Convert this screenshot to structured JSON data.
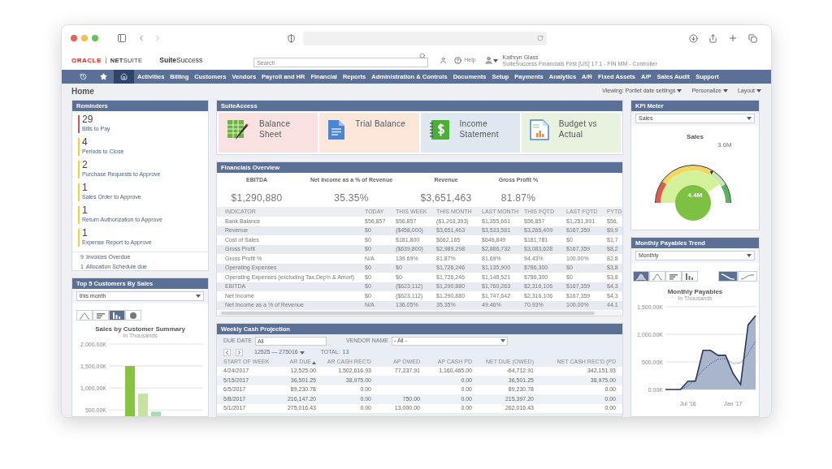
{
  "header": {
    "brand": "ORACLE",
    "product": "**NET**SUITE",
    "edition": "**Suite**Success",
    "search": {
      "placeholder": "Search"
    },
    "help": "Help",
    "user": {
      "name": "Kathryn Glass",
      "role": "SuiteSuccess Financials First [US] 17.1 - FIN MM - Controller"
    }
  },
  "nav": {
    "icons": [
      {
        "kind": "recent",
        "selected": false
      },
      {
        "kind": "favorites",
        "selected": false
      },
      {
        "kind": "home",
        "selected": true
      }
    ],
    "items": [
      "Activities",
      "Billing",
      "Customers",
      "Vendors",
      "Payroll and HR",
      "Financial",
      "Reports",
      "Administration & Controls",
      "Documents",
      "Setup",
      "Payments",
      "Analytics",
      "A/R",
      "Fixed Assets",
      "A/P",
      "Sales Audit",
      "Support"
    ]
  },
  "page": {
    "title": "Home",
    "links": [
      "Viewing: Portlet date settings",
      "Personalize",
      "Layout"
    ]
  },
  "reminders": {
    "title": "Reminders",
    "items": [
      {
        "count": "29",
        "label": "Bills to Pay",
        "color": "#d9534f"
      },
      {
        "count": "4",
        "label": "Periods to Close",
        "color": "#f2d22e"
      },
      {
        "count": "2",
        "label": "Purchase Requests to Approve",
        "color": "#f2d22e"
      },
      {
        "count": "1",
        "label": "Sales Order to Approve",
        "color": "#f2d22e"
      },
      {
        "count": "1",
        "label": "Return Authorization to Approve",
        "color": "#f2d22e"
      },
      {
        "count": "1",
        "label": "Expense Report to Approve",
        "color": "#f2d22e"
      }
    ],
    "other": [
      {
        "count": "9",
        "label": "Invoices Overdue"
      },
      {
        "count": "1",
        "label": "Allocation Schedule due"
      }
    ]
  },
  "top_customers": {
    "title": "Top 5 Customers By Sales",
    "period": "this month",
    "chart_types": [
      {
        "kind": "line",
        "selected": false
      },
      {
        "kind": "bar",
        "selected": false
      },
      {
        "kind": "column",
        "selected": true
      },
      {
        "kind": "pie",
        "selected": false
      }
    ],
    "chart_data": {
      "type": "bar",
      "title": "Sales by Customer Summary",
      "subtitle": "In Thousands",
      "grid": true,
      "stacked": false,
      "categories": [
        null
      ],
      "ylim": [
        300,
        2000
      ],
      "yticks": [
        {
          "value": 500,
          "label": "500.00K"
        },
        {
          "value": 1000,
          "label": "1,000.00K"
        },
        {
          "value": 1500,
          "label": "1,500.00K"
        },
        {
          "value": 2000,
          "label": "2,000.00K"
        }
      ],
      "series": [
        {
          "color": "#86c440",
          "values": [
            1500
          ]
        },
        {
          "color": "#c6e3a0",
          "values": [
            870
          ]
        },
        {
          "color": "#a9dcb0",
          "values": [
            460
          ]
        }
      ]
    }
  },
  "suite_access": {
    "title": "SuiteAccess",
    "tiles": [
      {
        "kind": "sheet",
        "label": "Balance\nSheet",
        "color": "#fbe2e2"
      },
      {
        "kind": "document",
        "label": "Trial Balance",
        "color": "#fde7da"
      },
      {
        "kind": "dollar",
        "label": "Income\nStatement",
        "color": "#dfe8f1"
      },
      {
        "kind": "report",
        "label": "Budget vs\nActual",
        "color": "#e9f1df"
      }
    ]
  },
  "financials": {
    "title": "Financials Overview",
    "kpis": [
      {
        "label": "EBITDA",
        "value": "$1,290,880"
      },
      {
        "label": "Net Income as a % of Revenue",
        "value": "35.35%"
      },
      {
        "label": "Revenue",
        "value": "$3,651,463"
      },
      {
        "label": "Gross Profit %",
        "value": "81.87%"
      }
    ],
    "columns": [
      "INDICATOR",
      "TODAY",
      "THIS WEEK",
      "THIS MONTH",
      "LAST MONTH",
      "THIS FQTD",
      "LAST FQTD",
      "FYTD"
    ],
    "rows": [
      [
        "Bank Balance",
        "$56,857",
        "$56,857",
        "($1,263,393)",
        "$1,355,661",
        "$56,857",
        "$1,251,891",
        "$56,"
      ],
      [
        "Revenue",
        "$0",
        "($458,000)",
        "$3,651,463",
        "$3,533,581",
        "$3,265,409",
        "$167,359",
        "$9,9"
      ],
      [
        "Cost of Sales",
        "$0",
        "$181,800",
        "$662,165",
        "$646,849",
        "$181,781",
        "$0",
        "$1,7"
      ],
      [
        "Gross Profit",
        "$0",
        "($639,800)",
        "$2,989,298",
        "$2,886,732",
        "$3,083,628",
        "$167,359",
        "$8,2"
      ],
      [
        "Gross Profit %",
        "N/A",
        "139.69%",
        "81.87%",
        "81.69%",
        "94.43%",
        "100.00%",
        "82.8"
      ],
      [
        "Operating Expenses",
        "$0",
        "$0",
        "$1,726,246",
        "$1,135,900",
        "$786,300",
        "$0",
        "$3,8"
      ],
      [
        "Operating Expenses (excluding Tax,Dep'n & Amort)",
        "$0",
        "$0",
        "$1,726,246",
        "$1,148,521",
        "$786,300",
        "$0",
        "$3,8"
      ],
      [
        "EBITDA",
        "$0",
        "($623,112)",
        "$1,290,880",
        "$1,760,263",
        "$2,316,106",
        "$167,359",
        "$4,3"
      ],
      [
        "Net Income",
        "$0",
        "($623,112)",
        "$1,290,880",
        "$1,747,642",
        "$2,316,106",
        "$167,359",
        "$4,3"
      ],
      [
        "Net Income as a % of Revenue",
        "N/A",
        "136.05%",
        "35.35%",
        "49.46%",
        "70.93%",
        "100.00%",
        "44.1"
      ]
    ]
  },
  "cash_projection": {
    "title": "Weekly Cash Projection",
    "filters": [
      {
        "label": "DUE DATE",
        "kind": "text",
        "value": "All"
      },
      {
        "label": "VENDOR NAME",
        "kind": "select",
        "value": "- All -"
      }
    ],
    "range": "12525 — 275016",
    "total_label": "TOTAL:",
    "total": "13",
    "columns": [
      {
        "label": "START OF WEEK",
        "sorted": false
      },
      {
        "label": "AR DUE",
        "sorted": true
      },
      {
        "label": "AR CASH REC'D",
        "sorted": false
      },
      {
        "label": "AP OWED",
        "sorted": false
      },
      {
        "label": "AP CASH PD",
        "sorted": false
      },
      {
        "label": "NET DUE (OWED)",
        "sorted": false
      },
      {
        "label": "NET CASH REC'D (PD",
        "sorted": false
      }
    ],
    "rows": [
      [
        "4/24/2017",
        "12,525.00",
        "1,502,616.93",
        "77,237.91",
        "1,160,465.00",
        "-64,712.91",
        "342,151.93"
      ],
      [
        "5/15/2017",
        "36,501.25",
        "38,975.00",
        null,
        "0.00",
        "36,501.25",
        "38,975.00"
      ],
      [
        "6/5/2017",
        "89,230.78",
        "0.00",
        null,
        "0.00",
        "89,230.78",
        "0.00"
      ],
      [
        "5/8/2017",
        "216,147.20",
        "0.00",
        "750.00",
        "0.00",
        "215,397.20",
        "0.00"
      ],
      [
        "5/1/2017",
        "275,016.43",
        "0.00",
        "13,000.00",
        "0.00",
        "262,016.43",
        "0.00"
      ]
    ]
  },
  "kpi_meter": {
    "title": "KPI Meter",
    "metric": "Sales",
    "gauge_title": "Sales",
    "target": "3.6M",
    "value": "4.4M"
  },
  "payables": {
    "title": "Monthly Payables Trend",
    "period": "Monthly",
    "chart_types": [
      {
        "kind": "area",
        "selected": true
      },
      {
        "kind": "line",
        "selected": false
      },
      {
        "kind": "bar",
        "selected": false
      },
      {
        "kind": "column",
        "selected": false
      }
    ],
    "smoothing": [
      {
        "kind": "curve",
        "selected": true
      },
      {
        "kind": "smooth",
        "selected": false
      }
    ],
    "chart_data": {
      "type": "area",
      "title": "Monthly Payables",
      "subtitle": "In Thousands",
      "grid": true,
      "ylim": [
        0,
        1500
      ],
      "categories": [
        null,
        null,
        null,
        "Jul '16",
        null,
        null,
        null,
        null,
        null,
        "Jan '17",
        null,
        null,
        null
      ],
      "yticks": [
        {
          "value": 0,
          "label": "0.00K"
        },
        {
          "value": 500,
          "label": "500.00K"
        },
        {
          "value": 1000,
          "label": "1,000.00K"
        },
        {
          "value": 1500,
          "label": "1,500.00K"
        }
      ],
      "series": [
        {
          "type": "area",
          "color": "#263a5e",
          "values": [
            0,
            0,
            0,
            150,
            150,
            710,
            710,
            620,
            620,
            290,
            90,
            1170,
            1340
          ]
        },
        {
          "type": "line",
          "line_style": "dashed",
          "color": "#263a5e",
          "values": [
            null,
            null,
            0,
            60,
            200,
            350,
            470,
            550,
            560,
            470,
            480,
            650,
            880
          ]
        }
      ]
    }
  }
}
